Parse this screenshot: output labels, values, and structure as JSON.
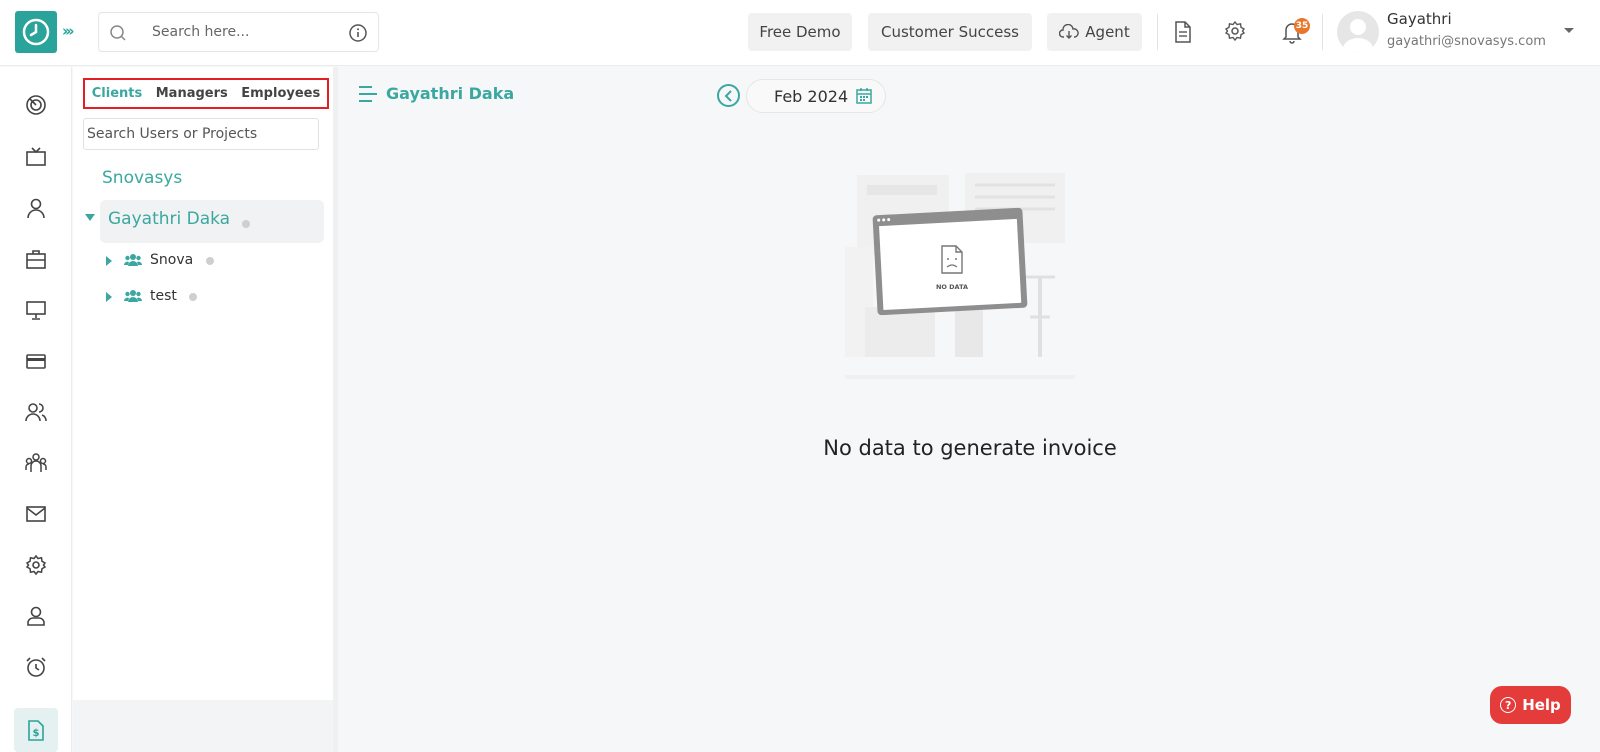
{
  "header": {
    "search_placeholder": "Search here...",
    "free_demo": "Free Demo",
    "customer_success": "Customer Success",
    "agent": "Agent",
    "notification_count": "35",
    "user_name": "Gayathri",
    "user_email": "gayathri@snovasys.com"
  },
  "rail": {
    "items": [
      "dashboard-icon",
      "monitor-tv-icon",
      "user-icon",
      "briefcase-icon",
      "desktop-icon",
      "card-icon",
      "users-icon",
      "team-icon",
      "mail-icon",
      "settings-icon",
      "profile-icon",
      "alarm-icon",
      "invoice-icon"
    ],
    "active": "invoice-icon"
  },
  "panel": {
    "tabs": [
      "Clients",
      "Managers",
      "Employees"
    ],
    "active_tab": "Clients",
    "search_placeholder": "Search Users or Projects",
    "org_name": "Snovasys",
    "selected_user": "Gayathri Daka",
    "groups": [
      {
        "name": "Snova"
      },
      {
        "name": "test"
      }
    ]
  },
  "main": {
    "title": "Gayathri Daka",
    "month": "Feb 2024",
    "empty_label": "NO DATA",
    "empty_message": "No data to generate invoice"
  },
  "help": {
    "label": "Help"
  },
  "colors": {
    "accent": "#3aa8a0",
    "logo": "#2aa39b",
    "help": "#e43b3b",
    "badge": "#e8772e",
    "highlight_border": "#e41e26"
  }
}
